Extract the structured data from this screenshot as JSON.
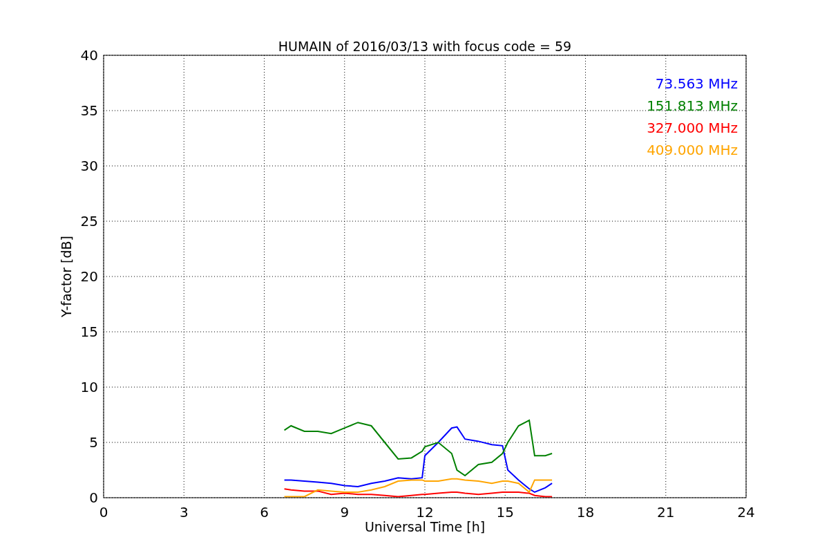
{
  "chart_data": {
    "type": "line",
    "title": "HUMAIN of 2016/03/13 with focus code = 59",
    "xlabel": "Universal Time [h]",
    "ylabel": "Y-factor [dB]",
    "x": [
      6.75,
      7,
      7.5,
      8,
      8.5,
      9,
      9.5,
      10,
      10.5,
      11,
      11.5,
      11.9,
      12,
      12.5,
      13,
      13.2,
      13.5,
      14,
      14.5,
      14.9,
      15.1,
      15.5,
      15.9,
      16.1,
      16.5,
      16.75
    ],
    "series": [
      {
        "name": "73.563 MHz",
        "color": "#0000ff",
        "values": [
          1.6,
          1.6,
          1.5,
          1.4,
          1.3,
          1.1,
          1.0,
          1.3,
          1.5,
          1.8,
          1.7,
          1.8,
          3.8,
          5.0,
          6.3,
          6.4,
          5.3,
          5.1,
          4.8,
          4.7,
          2.5,
          1.6,
          0.8,
          0.5,
          0.9,
          1.3
        ]
      },
      {
        "name": "151.813 MHz",
        "color": "#008000",
        "values": [
          6.1,
          6.5,
          6.0,
          6.0,
          5.8,
          6.3,
          6.8,
          6.5,
          5.0,
          3.5,
          3.6,
          4.2,
          4.6,
          5.0,
          4.0,
          2.5,
          2.0,
          3.0,
          3.2,
          4.0,
          5.0,
          6.5,
          7.0,
          3.8,
          3.8,
          4.0
        ]
      },
      {
        "name": "327.000 MHz",
        "color": "#ff0000",
        "values": [
          0.8,
          0.7,
          0.6,
          0.6,
          0.3,
          0.4,
          0.3,
          0.3,
          0.2,
          0.1,
          0.2,
          0.3,
          0.3,
          0.4,
          0.5,
          0.5,
          0.4,
          0.3,
          0.4,
          0.5,
          0.5,
          0.5,
          0.4,
          0.2,
          0.1,
          0.1
        ]
      },
      {
        "name": "409.000 MHz",
        "color": "#ffa500",
        "values": [
          0.1,
          0.1,
          0.1,
          0.7,
          0.6,
          0.5,
          0.5,
          0.7,
          1.0,
          1.5,
          1.6,
          1.6,
          1.5,
          1.5,
          1.7,
          1.7,
          1.6,
          1.5,
          1.3,
          1.5,
          1.5,
          1.3,
          0.5,
          1.6,
          1.6,
          1.6
        ]
      }
    ],
    "grid": true,
    "xlim": [
      0,
      24
    ],
    "ylim": [
      0,
      40
    ],
    "xticks": [
      0,
      3,
      6,
      9,
      12,
      15,
      18,
      21,
      24
    ],
    "yticks": [
      0,
      5,
      10,
      15,
      20,
      25,
      30,
      35,
      40
    ]
  }
}
